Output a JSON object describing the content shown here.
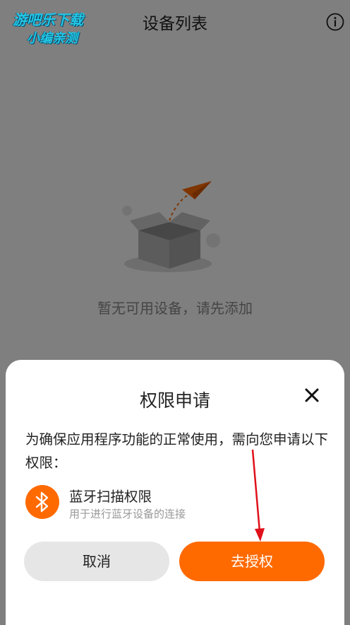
{
  "watermark": {
    "line1": "游吧乐下载",
    "line2": "小编亲测"
  },
  "header": {
    "title": "设备列表",
    "info_icon": "info-icon"
  },
  "empty_state": {
    "illustration": "empty-box-paper-plane",
    "message": "暂无可用设备，请先添加"
  },
  "dialog": {
    "title": "权限申请",
    "close_icon": "close-icon",
    "description": "为确保应用程序功能的正常使用，需向您申请以下权限：",
    "permissions": [
      {
        "icon": "bluetooth-icon",
        "name": "蓝牙扫描权限",
        "description": "用于进行蓝牙设备的连接"
      }
    ],
    "cancel_label": "取消",
    "authorize_label": "去授权"
  },
  "colors": {
    "accent": "#ff6a00",
    "overlay": "rgba(0,0,0,0.5)",
    "annotation_arrow": "#e0101a"
  }
}
